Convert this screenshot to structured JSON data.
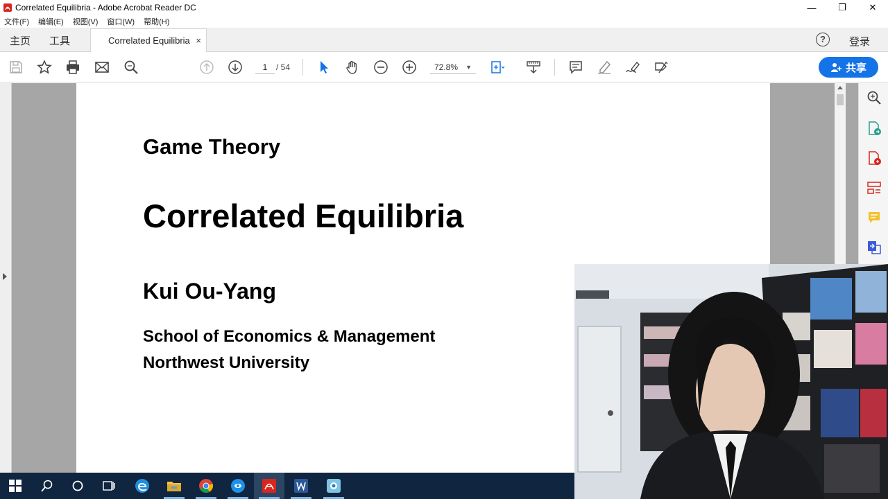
{
  "window": {
    "title": "Correlated Equilibria - Adobe Acrobat Reader DC",
    "minimize": "—",
    "restore": "❐",
    "close": "✕"
  },
  "menu": {
    "items": [
      "文件(F)",
      "编辑(E)",
      "视图(V)",
      "窗口(W)",
      "帮助(H)"
    ]
  },
  "tabs": {
    "home": "主页",
    "tools": "工具",
    "document": "Correlated Equilibria",
    "close": "×",
    "help": "?",
    "login": "登录"
  },
  "toolbar": {
    "current_page": "1",
    "total_pages": "/ 54",
    "zoom": "72.8%",
    "share": "共享"
  },
  "document": {
    "course": "Game Theory",
    "title": "Correlated Equilibria",
    "author": "Kui Ou-Yang",
    "school": "School of Economics & Management",
    "university": "Northwest University"
  },
  "colors": {
    "accent": "#1473e6",
    "acrobat_red": "#d7261e",
    "taskbar": "#10253f"
  }
}
